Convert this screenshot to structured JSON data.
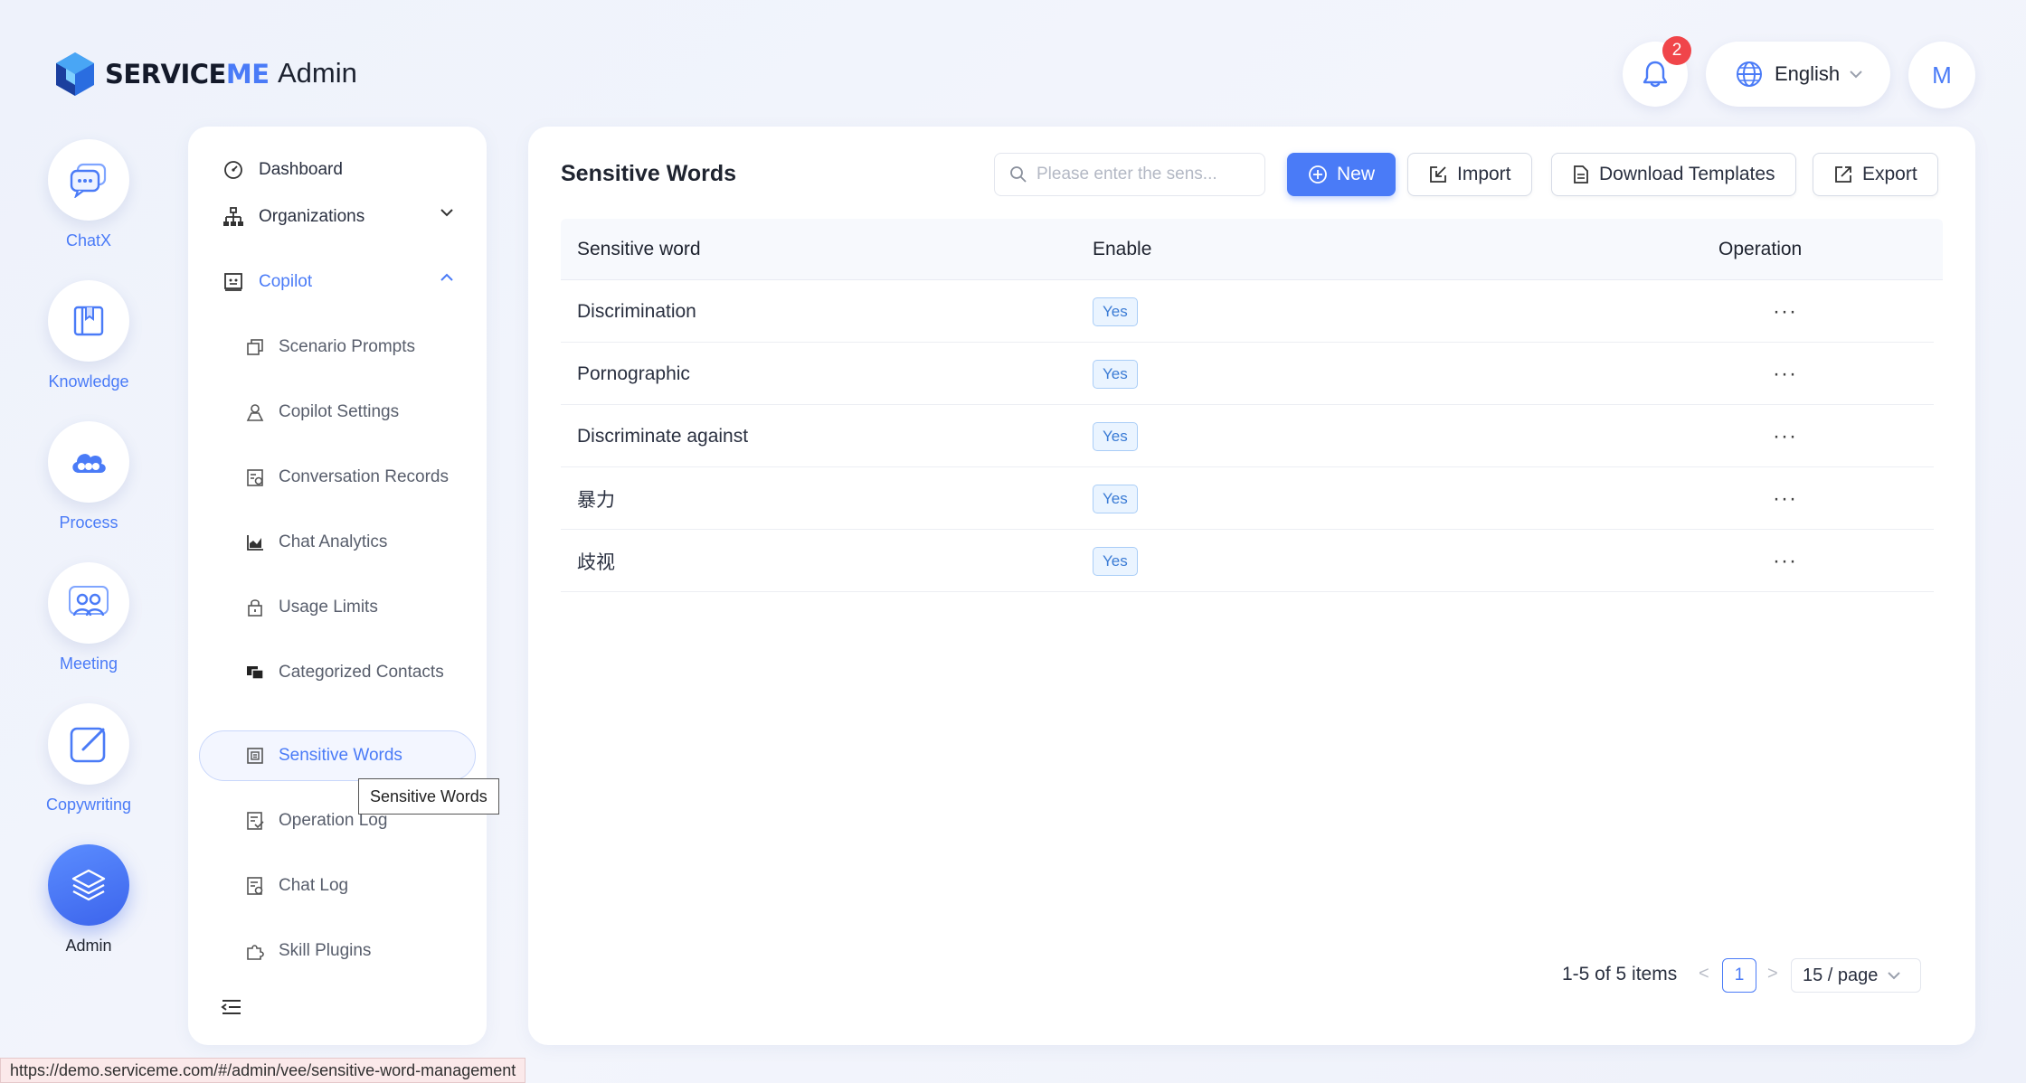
{
  "brand": {
    "name_prefix": "SERVICE",
    "name_suffix": "ME",
    "section_title": "Admin"
  },
  "header": {
    "notification_count": "2",
    "language": "English",
    "avatar_initial": "M"
  },
  "rail": {
    "items": [
      {
        "label": "ChatX",
        "icon": "chat-icon"
      },
      {
        "label": "Knowledge",
        "icon": "book-icon"
      },
      {
        "label": "Process",
        "icon": "cloud-flow-icon"
      },
      {
        "label": "Meeting",
        "icon": "people-icon"
      },
      {
        "label": "Copywriting",
        "icon": "edit-icon"
      },
      {
        "label": "Admin",
        "icon": "layers-icon",
        "active": true
      }
    ]
  },
  "nav": {
    "dashboard": "Dashboard",
    "organizations": "Organizations",
    "copilot": "Copilot",
    "sub_items": [
      "Scenario Prompts",
      "Copilot Settings",
      "Conversation Records",
      "Chat Analytics",
      "Usage Limits",
      "Categorized Contacts",
      "Sensitive Words",
      "Operation Log",
      "Chat Log",
      "Skill Plugins"
    ],
    "tooltip": "Sensitive Words"
  },
  "main": {
    "title": "Sensitive Words",
    "search_placeholder": "Please enter the sens...",
    "buttons": {
      "new": "New",
      "import": "Import",
      "download_templates": "Download Templates",
      "export": "Export"
    },
    "table": {
      "columns": [
        "Sensitive word",
        "Enable",
        "Operation"
      ],
      "rows": [
        {
          "word": "Discrimination",
          "enable": "Yes",
          "op": "···"
        },
        {
          "word": "Pornographic",
          "enable": "Yes",
          "op": "···"
        },
        {
          "word": "Discriminate against",
          "enable": "Yes",
          "op": "···"
        },
        {
          "word": "暴力",
          "enable": "Yes",
          "op": "···"
        },
        {
          "word": "歧视",
          "enable": "Yes",
          "op": "···"
        }
      ]
    },
    "pagination": {
      "total": "1-5 of 5 items",
      "prev": "<",
      "current": "1",
      "next": ">",
      "page_size": "15 / page"
    }
  },
  "status_url": "https://demo.serviceme.com/#/admin/vee/sensitive-word-management",
  "colors": {
    "accent": "#4a7bf7",
    "badge": "#f0454a",
    "tag_bg": "#eaf4ff"
  }
}
